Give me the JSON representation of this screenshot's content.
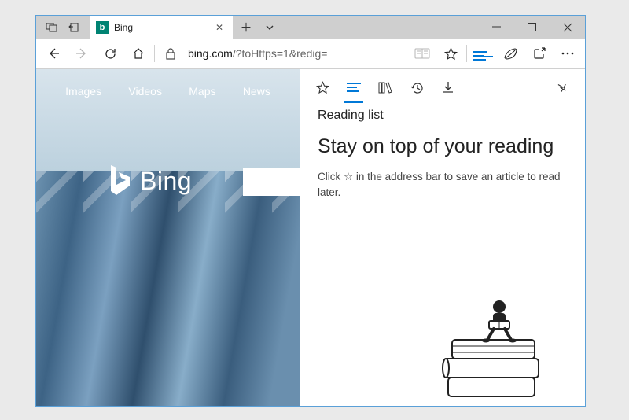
{
  "tab": {
    "title": "Bing",
    "favicon_letter": "b"
  },
  "addressbar": {
    "host": "bing.com",
    "path": "/?toHttps=1&redig="
  },
  "page": {
    "nav": [
      "Images",
      "Videos",
      "Maps",
      "News"
    ],
    "logo_text": "Bing"
  },
  "hub": {
    "section_title": "Reading list",
    "headline": "Stay on top of your reading",
    "hint_prefix": "Click ",
    "hint_icon": "☆",
    "hint_suffix": " in the address bar to save an article to read later."
  }
}
